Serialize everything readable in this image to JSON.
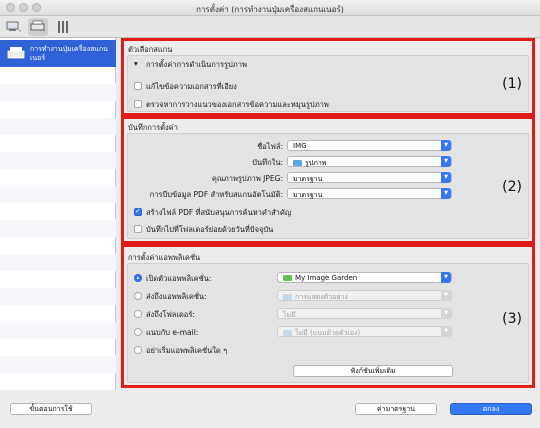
{
  "window": {
    "title": "การตั้งค่า (การทำงานปุ่มเครื่องสแกนเนอร์)"
  },
  "toolbar": {
    "icons": [
      "scan-from-computer-icon",
      "scan-from-operation-panel-icon",
      "general-settings-icon"
    ]
  },
  "sidebar": {
    "selected_label": "การทำงานปุ่มเครื่องสแกนเนอร์"
  },
  "scan_options": {
    "header": "ตัวเลือกสแกน",
    "number": "(1)",
    "image_processing_header": "การตั้งค่าการดำเนินการรูปภาพ",
    "checkbox1": "แก้ไขข้อความเอกสารที่เอียง",
    "checkbox2": "ตรวจหาการวางแนวของเอกสารข้อความและหมุนรูปภาพ"
  },
  "save_settings": {
    "header": "บันทึกการตั้งค่า",
    "number": "(2)",
    "file_name_label": "ชื่อไฟล์:",
    "file_name_value": "IMG",
    "save_in_label": "บันทึกใน:",
    "save_in_value": "รูปภาพ",
    "jpeg_quality_label": "คุณภาพรูปภาพ JPEG:",
    "jpeg_quality_value": "มาตรฐาน",
    "pdf_compression_label": "การบีบข้อมูล PDF สำหรับสแกนอัตโนมัติ:",
    "pdf_compression_value": "มาตรฐาน",
    "checkbox1": "สร้างไฟล์ PDF ที่สนับสนุนการค้นหาคำสำคัญ",
    "checkbox2": "บันทึกไปที่โฟลเดอร์ย่อยด้วยวันที่ปัจจุบัน"
  },
  "app_settings": {
    "header": "การตั้งค่าแอพพลิเคชั่น",
    "number": "(3)",
    "radio1": "เปิดตัวแอพพลิเคชั่น:",
    "radio1_value": "My Image Garden",
    "radio2": "ส่งถึงแอพพลิเคชั่น:",
    "radio2_value": "การแสดงตัวอย่าง",
    "radio3": "ส่งถึงโฟลเดอร์:",
    "radio3_value": "ไม่มี",
    "radio4": "แนบกับ e-mail:",
    "radio4_value": "ไม่มี (แนบด้วยตัวเอง)",
    "radio5": "อย่าเริ่มแอพพลิเคชั่นใด ๆ",
    "more_functions": "ฟังก์ชันเพิ่มเติม"
  },
  "footer": {
    "instructions": "ขั้นตอนการใช้",
    "defaults": "ค่ามาตรฐาน",
    "ok": "ตกลง"
  },
  "colors": {
    "highlight_box": "#e21b1b",
    "accent": "#3478f6",
    "sidebar_selected": "#2e62d6"
  }
}
